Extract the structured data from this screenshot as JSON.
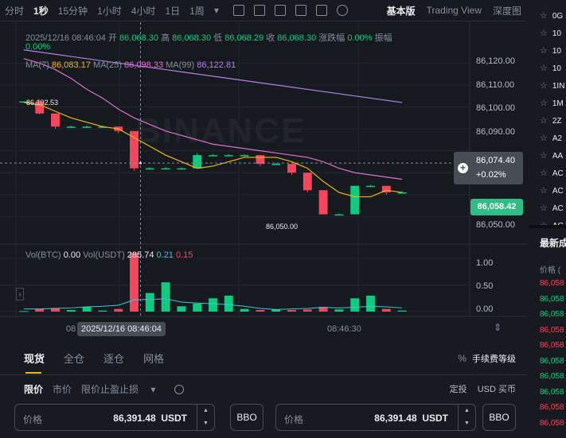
{
  "toolbar": {
    "intervals": [
      "分时",
      "1秒",
      "15分钟",
      "1小时",
      "4小时",
      "1日",
      "1周"
    ],
    "active_interval": "1秒",
    "dropdown": "▾",
    "views": [
      "基本版",
      "Trading View",
      "深度图"
    ],
    "active_view": "基本版"
  },
  "legend": {
    "ohlc": {
      "time": "2025/12/16 08:46:04",
      "open_label": "开",
      "open": "86,068.30",
      "high_label": "高",
      "high": "86,068.30",
      "low_label": "低",
      "low": "86,068.29",
      "close_label": "收",
      "close": "86,068.30",
      "change_label": "涨跌幅",
      "change": "0.00%",
      "amp_label": "振幅",
      "amp": "0.00%"
    },
    "ma": {
      "ma7_label": "MA(7)",
      "ma7": "86,083.17",
      "ma25_label": "MA(25)",
      "ma25": "86,098.33",
      "ma99_label": "MA(99)",
      "ma99": "86,122.81"
    },
    "vol": {
      "btc_label": "Vol(BTC)",
      "btc": "0.00",
      "usdt_label": "Vol(USDT)",
      "usdt": "285.74",
      "a": "0.21",
      "b": "0.15"
    }
  },
  "price_axis": [
    "86,120.00",
    "86,110.00",
    "86,100.00",
    "86,090.00",
    "86,050.00"
  ],
  "vol_axis": [
    "1.00",
    "0.50",
    "0.00"
  ],
  "x_axis": [
    "08:46:30"
  ],
  "x_axis_partial": "08",
  "crosshair": {
    "time": "2025/12/16 08:46:04",
    "price": "86,074.40",
    "pct": "+0.02%"
  },
  "last_price": "86,058.42",
  "high_label": "86,102.53",
  "low_label": "86,050.00",
  "watermark": "BINANCE",
  "chart_data": {
    "type": "candlestick",
    "ylim": [
      86040,
      86127
    ],
    "candles": [
      [
        86102.5,
        86102.5,
        86102.5,
        86102.5
      ],
      [
        86102.5,
        86103.5,
        86096.5,
        86097
      ],
      [
        86097,
        86097,
        86090,
        86091
      ],
      [
        86091,
        86091.5,
        86090.5,
        86091
      ],
      [
        86091,
        86091.5,
        86090.5,
        86091
      ],
      [
        86091,
        86091.5,
        86090.5,
        86091
      ],
      [
        86091,
        86091,
        86088,
        86089
      ],
      [
        86089,
        86089,
        86071,
        86072
      ],
      [
        86072,
        86072.5,
        86071.5,
        86072
      ],
      [
        86072,
        86072.5,
        86071.5,
        86072
      ],
      [
        86072,
        86072.5,
        86071.5,
        86072
      ],
      [
        86072,
        86079,
        86072,
        86078
      ],
      [
        86078,
        86078.5,
        86077.5,
        86078
      ],
      [
        86078,
        86078.5,
        86077.5,
        86078
      ],
      [
        86078,
        86078.5,
        86077.5,
        86078
      ],
      [
        86078,
        86078,
        86073,
        86074
      ],
      [
        86074,
        86074.5,
        86073.5,
        86074
      ],
      [
        86074,
        86074,
        86069,
        86070
      ],
      [
        86070,
        86070,
        86061,
        86062
      ],
      [
        86062,
        86062,
        86051,
        86051
      ],
      [
        86051,
        86051.5,
        86050.5,
        86051
      ],
      [
        86051,
        86064,
        86051,
        86064
      ],
      [
        86064,
        86064.5,
        86063.5,
        86064
      ],
      [
        86064,
        86064,
        86060,
        86061
      ],
      [
        86061,
        86061.5,
        86060.5,
        86061
      ]
    ],
    "ma7": [
      86102,
      86101,
      86098,
      86095,
      86093,
      86091,
      86090,
      86086,
      86082,
      86078,
      86075,
      86072,
      86073,
      86075,
      86077,
      86077,
      86077,
      86075,
      86072,
      86066,
      86061,
      86059,
      86059,
      86062,
      86061
    ],
    "ma25": [
      86122,
      86120,
      86117,
      86113,
      86108,
      86104,
      86099,
      86095,
      86092,
      86089,
      86087,
      86085,
      86083,
      86082,
      86081,
      86080,
      86079,
      86078,
      86077,
      86075,
      86072,
      86070,
      86069,
      86068,
      86067
    ],
    "ma99": [
      86126,
      86125,
      86124,
      86123,
      86122,
      86121,
      86120,
      86119,
      86118,
      86117,
      86116,
      86115,
      86114,
      86113,
      86112,
      86111,
      86110,
      86109,
      86108,
      86107,
      86106,
      86105,
      86104,
      86103,
      86102
    ],
    "vol_ylim": [
      0,
      1.15
    ],
    "volumes": [
      0.01,
      0.05,
      0.07,
      0.03,
      0.09,
      0.02,
      0.05,
      1.1,
      0.35,
      0.55,
      0.1,
      0.15,
      0.25,
      0.3,
      0.05,
      0.03,
      0.04,
      0.03,
      0.04,
      0.09,
      0.04,
      0.25,
      0.3,
      0.05,
      0.02
    ],
    "vol_ma": [
      0.05,
      0.05,
      0.06,
      0.07,
      0.09,
      0.1,
      0.12,
      0.22,
      0.23,
      0.24,
      0.18,
      0.16,
      0.15,
      0.13,
      0.1,
      0.06,
      0.04,
      0.05,
      0.06,
      0.08,
      0.07,
      0.08,
      0.1,
      0.09,
      0.07
    ]
  },
  "order": {
    "tabs": [
      "现货",
      "全仓",
      "逐仓",
      "网格"
    ],
    "active_tab": "现货",
    "fee_pct": "%",
    "fee_label": "手续费等级",
    "types": [
      "限价",
      "市价",
      "限价止盈止损"
    ],
    "type_dropdown": "▾",
    "buy_label": "定投",
    "usd_label": "USD 买币",
    "price_label": "价格",
    "price_value": "86,391.48",
    "unit": "USDT",
    "bbo": "BBO"
  },
  "right_panel": {
    "symbols": [
      "0G",
      "10",
      "10",
      "10",
      "1IN",
      "1M",
      "2Z",
      "A2",
      "AA",
      "AC",
      "AC",
      "AC",
      "AC"
    ],
    "trades_title": "最新成",
    "trades_head": "价格 (",
    "trades": [
      {
        "p": "86,058",
        "side": "sell"
      },
      {
        "p": "86,058",
        "side": "buy"
      },
      {
        "p": "86,058",
        "side": "buy"
      },
      {
        "p": "86,058",
        "side": "sell"
      },
      {
        "p": "86,058",
        "side": "sell"
      },
      {
        "p": "86,058",
        "side": "buy"
      },
      {
        "p": "86,058",
        "side": "buy"
      },
      {
        "p": "86,058",
        "side": "buy"
      },
      {
        "p": "86,058",
        "side": "sell"
      },
      {
        "p": "86,058",
        "side": "sell"
      }
    ]
  },
  "colors": {
    "up": "#0ecb81",
    "down": "#f6465d",
    "ma7": "#f0b90b",
    "ma25": "#dd6fd4",
    "ma99": "#b37feb",
    "vol_ma": "#3fc6e0"
  }
}
